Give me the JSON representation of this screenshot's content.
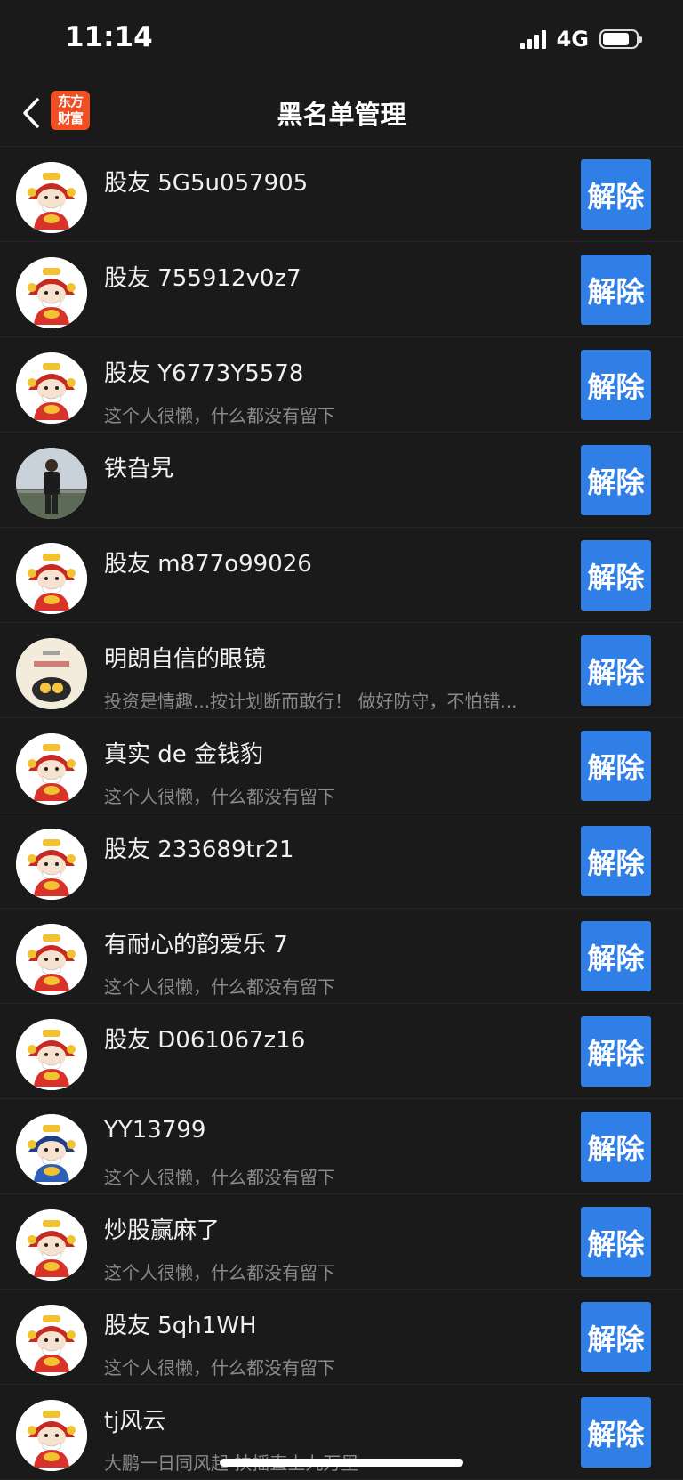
{
  "status_bar": {
    "time": "11:14",
    "network": "4G",
    "battery_level": 0.8
  },
  "nav": {
    "logo_line1": "东方",
    "logo_line2": "财富",
    "title": "黑名单管理"
  },
  "colors": {
    "accent": "#2f7fe6",
    "background": "#1a1a1a",
    "logo": "#f04e23"
  },
  "unblock_label": "解除",
  "users": [
    {
      "name": "股友 5G5u057905",
      "bio": "",
      "avatar": "caishen-red"
    },
    {
      "name": "股友 755912v0z7",
      "bio": "",
      "avatar": "caishen-red"
    },
    {
      "name": "股友 Y6773Y5578",
      "bio": "这个人很懒，什么都没有留下",
      "avatar": "caishen-red"
    },
    {
      "name": "铁旮旯",
      "bio": "",
      "avatar": "photo-person"
    },
    {
      "name": "股友 m877o99026",
      "bio": "",
      "avatar": "caishen-red"
    },
    {
      "name": "明朗自信的眼镜",
      "bio": "投资是情趣...按计划断而敢行！ 做好防守，不怕错...",
      "avatar": "cartoon-glasses"
    },
    {
      "name": "真实 de 金钱豹",
      "bio": "这个人很懒，什么都没有留下",
      "avatar": "caishen-red"
    },
    {
      "name": "股友 233689tr21",
      "bio": "",
      "avatar": "caishen-red"
    },
    {
      "name": "有耐心的韵爱乐 7",
      "bio": "这个人很懒，什么都没有留下",
      "avatar": "caishen-red"
    },
    {
      "name": "股友 D061067z16",
      "bio": "",
      "avatar": "caishen-red"
    },
    {
      "name": "YY13799",
      "bio": "这个人很懒，什么都没有留下",
      "avatar": "caishen-blue"
    },
    {
      "name": "炒股赢麻了",
      "bio": "这个人很懒，什么都没有留下",
      "avatar": "caishen-red"
    },
    {
      "name": "股友 5qh1WH",
      "bio": "这个人很懒，什么都没有留下",
      "avatar": "caishen-red"
    },
    {
      "name": "tj风云",
      "bio": "大鹏一日同风起 扶摇直上九万里",
      "avatar": "caishen-red"
    }
  ]
}
